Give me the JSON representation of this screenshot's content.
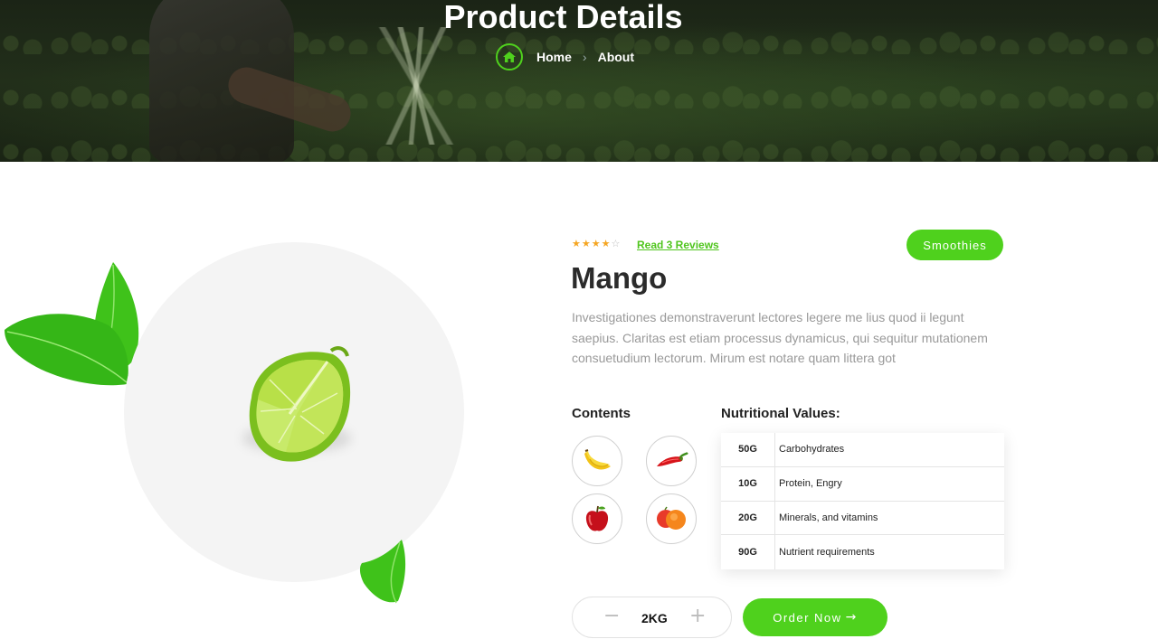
{
  "hero": {
    "title": "Product Details",
    "breadcrumb": {
      "home_icon": "home-icon",
      "items": [
        "Home",
        "About"
      ],
      "separator_icon": "chevron-right-icon"
    }
  },
  "product": {
    "rating": {
      "value": 4,
      "max": 5
    },
    "reviews_link": "Read 3 Reviews",
    "category": "Smoothies",
    "name": "Mango",
    "description": "Investigationes demonstraverunt lectores legere me lius quod ii legunt saepius. Claritas est etiam processus dynamicus, qui sequitur mutationem consuetudium lectorum. Mirum est notare quam littera got",
    "image_icon": "lime-slice-icon"
  },
  "contents": {
    "heading": "Contents",
    "items": [
      {
        "icon": "banana-icon"
      },
      {
        "icon": "chili-pepper-icon"
      },
      {
        "icon": "apple-icon"
      },
      {
        "icon": "peach-icon"
      }
    ]
  },
  "nutrition": {
    "heading": "Nutritional Values:",
    "rows": [
      {
        "amount": "50G",
        "label": "Carbohydrates"
      },
      {
        "amount": "10G",
        "label": "Protein, Engry"
      },
      {
        "amount": "20G",
        "label": "Minerals, and vitamins"
      },
      {
        "amount": "90G",
        "label": "Nutrient requirements"
      }
    ]
  },
  "order": {
    "quantity": "2KG",
    "minus_icon": "minus-icon",
    "plus_icon": "plus-icon",
    "button_label": "Order Now",
    "button_icon": "arrow-right-icon"
  },
  "colors": {
    "accent": "#4fd11d",
    "star": "#f5a623",
    "text_muted": "#999999"
  }
}
